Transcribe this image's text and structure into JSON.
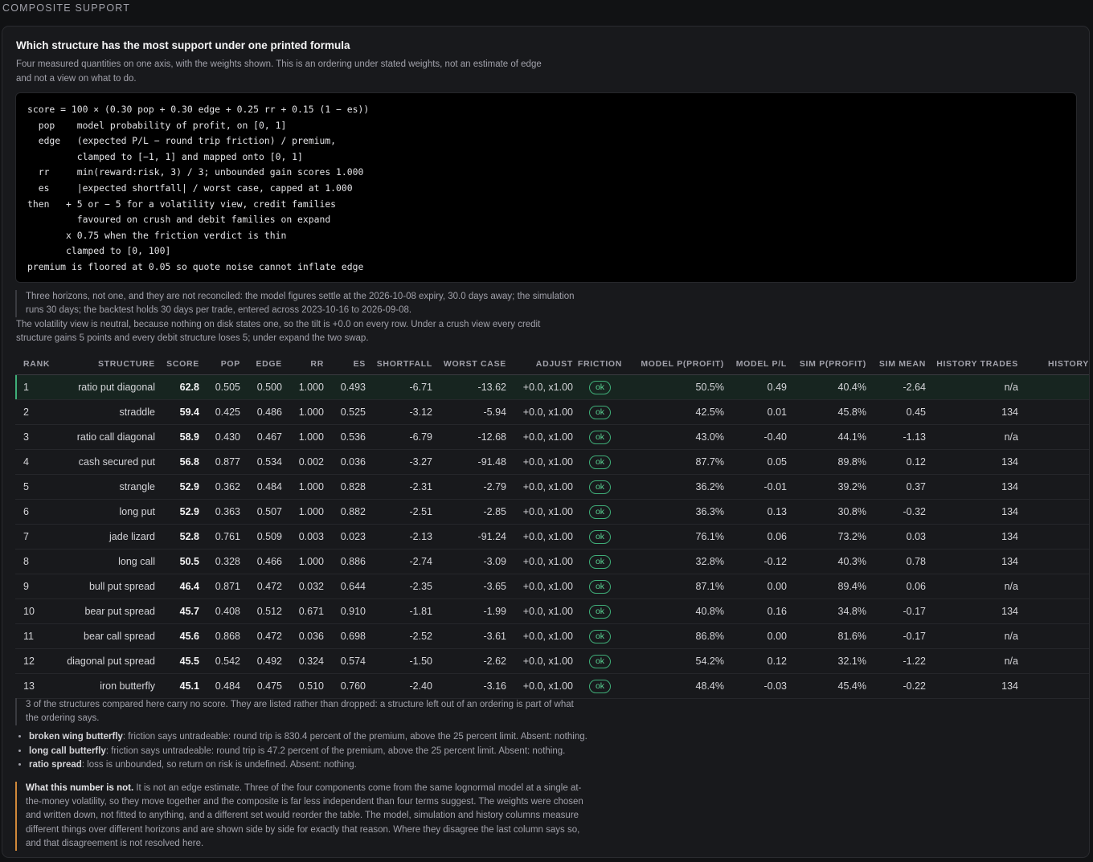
{
  "section_label": "COMPOSITE SUPPORT",
  "card": {
    "title": "Which structure has the most support under one printed formula",
    "subtitle": "Four measured quantities on one axis, with the weights shown. This is an ordering under stated weights, not an estimate of edge and not a view on what to do."
  },
  "formula_lines": [
    "score = 100 × (0.30 pop + 0.30 edge + 0.25 rr + 0.15 (1 − es))",
    "  pop    model probability of profit, on [0, 1]",
    "  edge   (expected P/L − round trip friction) / premium,",
    "         clamped to [−1, 1] and mapped onto [0, 1]",
    "  rr     min(reward:risk, 3) / 3; unbounded gain scores 1.000",
    "  es     |expected shortfall| / worst case, capped at 1.000",
    "then   + 5 or − 5 for a volatility view, credit families",
    "         favoured on crush and debit families on expand",
    "       x 0.75 when the friction verdict is thin",
    "       clamped to [0, 100]",
    "premium is floored at 0.05 so quote noise cannot inflate edge"
  ],
  "horizon_note": "Three horizons, not one, and they are not reconciled: the model figures settle at the 2026-10-08 expiry, 30.0 days away; the simulation runs 30 days; the backtest holds 30 days per trade, entered across 2023-10-16 to 2026-09-08.",
  "vol_note": "The volatility view is neutral, because nothing on disk states one, so the tilt is +0.0 on every row. Under a crush view every credit structure gains 5 points and every debit structure loses 5; under expand the two swap.",
  "table": {
    "headers": [
      "RANK",
      "STRUCTURE",
      "SCORE",
      "POP",
      "EDGE",
      "RR",
      "ES",
      "SHORTFALL",
      "WORST CASE",
      "ADJUST",
      "FRICTION",
      "MODEL P(PROFIT)",
      "MODEL P/L",
      "SIM P(PROFIT)",
      "SIM MEAN",
      "HISTORY TRADES",
      "HISTORY W"
    ],
    "rows": [
      {
        "rank": "1",
        "structure": "ratio put diagonal",
        "score": "62.8",
        "pop": "0.505",
        "edge": "0.500",
        "rr": "1.000",
        "es": "0.493",
        "shortfall": "-6.71",
        "worst": "-13.62",
        "adjust": "+0.0, x1.00",
        "friction": "ok",
        "model_pp": "50.5%",
        "model_pl": "0.49",
        "sim_pp": "40.4%",
        "sim_mean": "-2.64",
        "hist_trades": "n/a",
        "hist_w": ""
      },
      {
        "rank": "2",
        "structure": "straddle",
        "score": "59.4",
        "pop": "0.425",
        "edge": "0.486",
        "rr": "1.000",
        "es": "0.525",
        "shortfall": "-3.12",
        "worst": "-5.94",
        "adjust": "+0.0, x1.00",
        "friction": "ok",
        "model_pp": "42.5%",
        "model_pl": "0.01",
        "sim_pp": "45.8%",
        "sim_mean": "0.45",
        "hist_trades": "134",
        "hist_w": ""
      },
      {
        "rank": "3",
        "structure": "ratio call diagonal",
        "score": "58.9",
        "pop": "0.430",
        "edge": "0.467",
        "rr": "1.000",
        "es": "0.536",
        "shortfall": "-6.79",
        "worst": "-12.68",
        "adjust": "+0.0, x1.00",
        "friction": "ok",
        "model_pp": "43.0%",
        "model_pl": "-0.40",
        "sim_pp": "44.1%",
        "sim_mean": "-1.13",
        "hist_trades": "n/a",
        "hist_w": ""
      },
      {
        "rank": "4",
        "structure": "cash secured put",
        "score": "56.8",
        "pop": "0.877",
        "edge": "0.534",
        "rr": "0.002",
        "es": "0.036",
        "shortfall": "-3.27",
        "worst": "-91.48",
        "adjust": "+0.0, x1.00",
        "friction": "ok",
        "model_pp": "87.7%",
        "model_pl": "0.05",
        "sim_pp": "89.8%",
        "sim_mean": "0.12",
        "hist_trades": "134",
        "hist_w": ""
      },
      {
        "rank": "5",
        "structure": "strangle",
        "score": "52.9",
        "pop": "0.362",
        "edge": "0.484",
        "rr": "1.000",
        "es": "0.828",
        "shortfall": "-2.31",
        "worst": "-2.79",
        "adjust": "+0.0, x1.00",
        "friction": "ok",
        "model_pp": "36.2%",
        "model_pl": "-0.01",
        "sim_pp": "39.2%",
        "sim_mean": "0.37",
        "hist_trades": "134",
        "hist_w": ""
      },
      {
        "rank": "6",
        "structure": "long put",
        "score": "52.9",
        "pop": "0.363",
        "edge": "0.507",
        "rr": "1.000",
        "es": "0.882",
        "shortfall": "-2.51",
        "worst": "-2.85",
        "adjust": "+0.0, x1.00",
        "friction": "ok",
        "model_pp": "36.3%",
        "model_pl": "0.13",
        "sim_pp": "30.8%",
        "sim_mean": "-0.32",
        "hist_trades": "134",
        "hist_w": ""
      },
      {
        "rank": "7",
        "structure": "jade lizard",
        "score": "52.8",
        "pop": "0.761",
        "edge": "0.509",
        "rr": "0.003",
        "es": "0.023",
        "shortfall": "-2.13",
        "worst": "-91.24",
        "adjust": "+0.0, x1.00",
        "friction": "ok",
        "model_pp": "76.1%",
        "model_pl": "0.06",
        "sim_pp": "73.2%",
        "sim_mean": "0.03",
        "hist_trades": "134",
        "hist_w": ""
      },
      {
        "rank": "8",
        "structure": "long call",
        "score": "50.5",
        "pop": "0.328",
        "edge": "0.466",
        "rr": "1.000",
        "es": "0.886",
        "shortfall": "-2.74",
        "worst": "-3.09",
        "adjust": "+0.0, x1.00",
        "friction": "ok",
        "model_pp": "32.8%",
        "model_pl": "-0.12",
        "sim_pp": "40.3%",
        "sim_mean": "0.78",
        "hist_trades": "134",
        "hist_w": ""
      },
      {
        "rank": "9",
        "structure": "bull put spread",
        "score": "46.4",
        "pop": "0.871",
        "edge": "0.472",
        "rr": "0.032",
        "es": "0.644",
        "shortfall": "-2.35",
        "worst": "-3.65",
        "adjust": "+0.0, x1.00",
        "friction": "ok",
        "model_pp": "87.1%",
        "model_pl": "0.00",
        "sim_pp": "89.4%",
        "sim_mean": "0.06",
        "hist_trades": "n/a",
        "hist_w": ""
      },
      {
        "rank": "10",
        "structure": "bear put spread",
        "score": "45.7",
        "pop": "0.408",
        "edge": "0.512",
        "rr": "0.671",
        "es": "0.910",
        "shortfall": "-1.81",
        "worst": "-1.99",
        "adjust": "+0.0, x1.00",
        "friction": "ok",
        "model_pp": "40.8%",
        "model_pl": "0.16",
        "sim_pp": "34.8%",
        "sim_mean": "-0.17",
        "hist_trades": "134",
        "hist_w": ""
      },
      {
        "rank": "11",
        "structure": "bear call spread",
        "score": "45.6",
        "pop": "0.868",
        "edge": "0.472",
        "rr": "0.036",
        "es": "0.698",
        "shortfall": "-2.52",
        "worst": "-3.61",
        "adjust": "+0.0, x1.00",
        "friction": "ok",
        "model_pp": "86.8%",
        "model_pl": "0.00",
        "sim_pp": "81.6%",
        "sim_mean": "-0.17",
        "hist_trades": "n/a",
        "hist_w": ""
      },
      {
        "rank": "12",
        "structure": "diagonal put spread",
        "score": "45.5",
        "pop": "0.542",
        "edge": "0.492",
        "rr": "0.324",
        "es": "0.574",
        "shortfall": "-1.50",
        "worst": "-2.62",
        "adjust": "+0.0, x1.00",
        "friction": "ok",
        "model_pp": "54.2%",
        "model_pl": "0.12",
        "sim_pp": "32.1%",
        "sim_mean": "-1.22",
        "hist_trades": "n/a",
        "hist_w": ""
      },
      {
        "rank": "13",
        "structure": "iron butterfly",
        "score": "45.1",
        "pop": "0.484",
        "edge": "0.475",
        "rr": "0.510",
        "es": "0.760",
        "shortfall": "-2.40",
        "worst": "-3.16",
        "adjust": "+0.0, x1.00",
        "friction": "ok",
        "model_pp": "48.4%",
        "model_pl": "-0.03",
        "sim_pp": "45.4%",
        "sim_mean": "-0.22",
        "hist_trades": "134",
        "hist_w": ""
      }
    ]
  },
  "unscored_note": "3 of the structures compared here carry no score. They are listed rather than dropped: a structure left out of an ordering is part of what the ordering says.",
  "unscored": [
    {
      "name": "broken wing butterfly",
      "text": ": friction says untradeable: round trip is 830.4 percent of the premium, above the 25 percent limit. Absent: nothing."
    },
    {
      "name": "long call butterfly",
      "text": ": friction says untradeable: round trip is 47.2 percent of the premium, above the 25 percent limit. Absent: nothing."
    },
    {
      "name": "ratio spread",
      "text": ": loss is unbounded, so return on risk is undefined. Absent: nothing."
    }
  ],
  "caveat": {
    "lead": "What this number is not.",
    "body": " It is not an edge estimate. Three of the four components come from the same lognormal model at a single at-the-money volatility, so they move together and the composite is far less independent than four terms suggest. The weights were chosen and written down, not fitted to anything, and a different set would reorder the table. The model, simulation and history columns measure different things over different horizons and are shown side by side for exactly that reason. Where they disagree the last column says so, and that disagreement is not resolved here."
  },
  "colors": {
    "background": "#111214",
    "card": "#18191c",
    "accent_ok": "#3fae78",
    "caveat_bar": "#d0893a"
  }
}
